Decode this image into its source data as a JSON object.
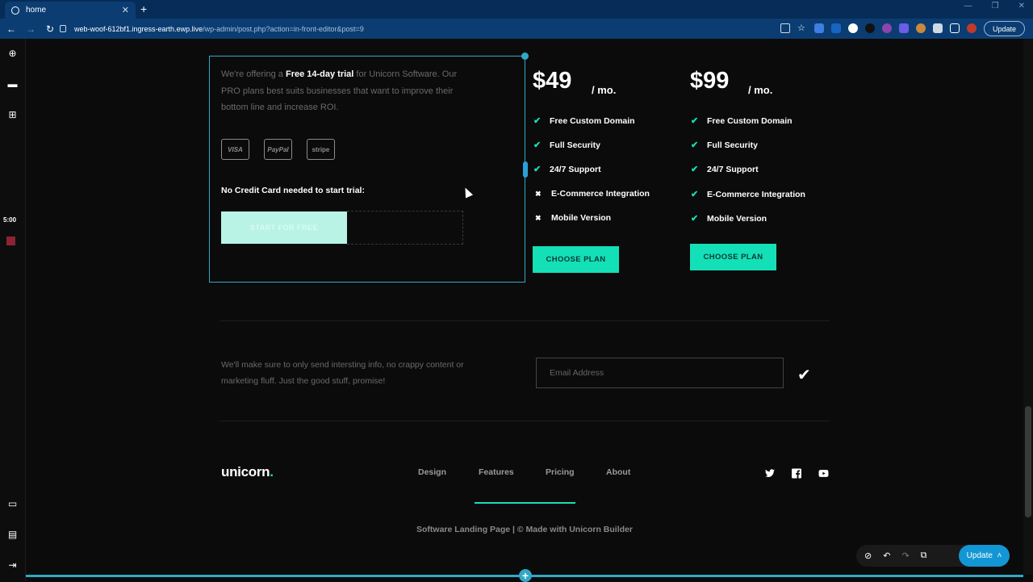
{
  "browser": {
    "tab_title": "home",
    "tab_close": "✕",
    "new_tab": "+",
    "url_host": "web-woof-612bf1.ingress-earth.ewp.live",
    "url_path": "/wp-admin/post.php?action=in-front-editor&post=9",
    "update_label": "Update"
  },
  "admin_bar": {
    "timer": "5:00"
  },
  "trial": {
    "text_before": "We're offering a ",
    "text_bold": "Free 14-day trial",
    "text_after": " for Unicorn Software. Our PRO plans best suits businesses that want to improve their bottom line and increase ROI.",
    "payment_methods": [
      "VISA",
      "PayPal",
      "stripe"
    ],
    "no_cc_label": "No Credit Card needed to start trial:",
    "start_button": "START FOR FREE"
  },
  "plans": [
    {
      "price": "$49",
      "period": "/ mo.",
      "features": [
        {
          "label": "Free Custom Domain",
          "included": true
        },
        {
          "label": "Full Security",
          "included": true
        },
        {
          "label": "24/7 Support",
          "included": true
        },
        {
          "label": "E-Commerce Integration",
          "included": false
        },
        {
          "label": "Mobile Version",
          "included": false
        }
      ],
      "button": "CHOOSE PLAN"
    },
    {
      "price": "$99",
      "period": "/ mo.",
      "features": [
        {
          "label": "Free Custom Domain",
          "included": true
        },
        {
          "label": "Full Security",
          "included": true
        },
        {
          "label": "24/7 Support",
          "included": true
        },
        {
          "label": "E-Commerce Integration",
          "included": true
        },
        {
          "label": "Mobile Version",
          "included": true
        }
      ],
      "button": "CHOOSE PLAN"
    }
  ],
  "newsletter": {
    "text": "We'll make sure to only send intersting info, no crappy content or marketing fluff. Just the good stuff, promise!",
    "email_placeholder": "Email Address"
  },
  "footer": {
    "logo_text": "unicorn",
    "logo_dot": ".",
    "nav": [
      "Design",
      "Features",
      "Pricing",
      "About"
    ],
    "social": [
      "twitter-icon",
      "facebook-icon",
      "youtube-icon"
    ],
    "copyright": "Software Landing Page | © Made with Unicorn Builder"
  },
  "builder_toolbar": {
    "update_label": "Update"
  },
  "colors": {
    "accent": "#14e0b8",
    "editor_blue": "#31a8c7",
    "browser_bar": "#0b3d73"
  }
}
